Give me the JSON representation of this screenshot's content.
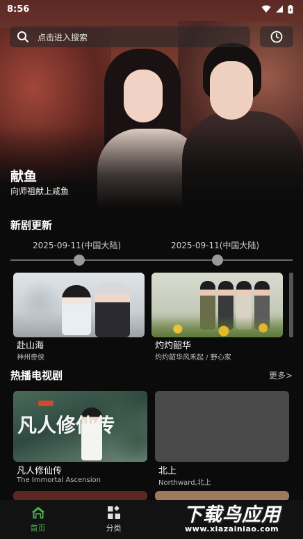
{
  "status_bar": {
    "time": "8:56",
    "icons": [
      "wifi-icon",
      "signal-icon",
      "battery-icon"
    ]
  },
  "search": {
    "placeholder": "点击进入搜索",
    "icon": "search-icon",
    "history_icon": "clock-icon"
  },
  "hero": {
    "title": "献鱼",
    "subtitle": "向师祖献上咸鱼"
  },
  "new_updates": {
    "title": "新剧更新",
    "timeline": [
      {
        "date": "2025-09-11(中国大陆)"
      },
      {
        "date": "2025-09-11(中国大陆)"
      }
    ],
    "items": [
      {
        "title": "赴山海",
        "subtitle": "神州奇侠"
      },
      {
        "title": "灼灼韶华",
        "subtitle": "灼灼韶华风禾起 / 野心家"
      }
    ]
  },
  "hot_tv": {
    "title": "热播电视剧",
    "more": "更多>",
    "items": [
      {
        "title": "凡人修仙传",
        "subtitle": "The Immortal Ascension",
        "poster_text": "凡人修仙传"
      },
      {
        "title": "北上",
        "subtitle": "Northward,北上"
      }
    ]
  },
  "bottom_nav": {
    "items": [
      {
        "label": "首页",
        "icon": "home-icon",
        "active": true
      },
      {
        "label": "分类",
        "icon": "category-icon",
        "active": false
      }
    ]
  },
  "watermark": {
    "text": "下载鸟应用",
    "url": "www.xiazainiao.com"
  },
  "colors": {
    "accent": "#4caf50",
    "background": "#0b0b0b",
    "nav_background": "#121212"
  }
}
